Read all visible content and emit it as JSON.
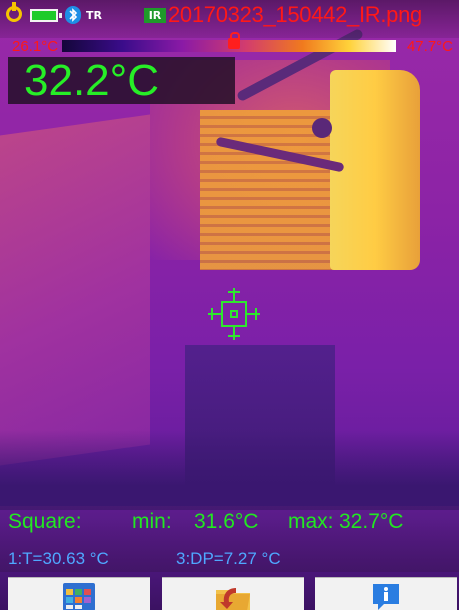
{
  "status_bar": {
    "icons": [
      "power-icon",
      "battery-icon",
      "bluetooth-icon",
      "tr-icon",
      "ir-image-icon"
    ],
    "tr_label": "TR",
    "ir_label": "IR",
    "filename": "20170323_150442_IR.png",
    "bluetooth_glyph": "฿",
    "colors": {
      "filename": "#ff1818",
      "battery": "#1ecb2a",
      "power": "#f5c400",
      "bluetooth": "#1e8fe6"
    }
  },
  "scale": {
    "min": "26.1°C",
    "max": "47.7°C",
    "lock_icon": "lock-icon"
  },
  "center_temp": "32.2°C",
  "measurement": {
    "square_label": "Square:",
    "min_label": "min:",
    "min_value": "31.6°C",
    "max_label": "max:",
    "max_value": "32.7°C",
    "point1": "1:T=30.63 °C",
    "point3": "3:DP=7.27 °C",
    "colors": {
      "measurement_text": "#22e822",
      "point_text": "#4fa8ff"
    }
  },
  "buttons": [
    {
      "name": "gallery-button",
      "icon": "gallery-grid-icon"
    },
    {
      "name": "folder-button",
      "icon": "folder-return-icon"
    },
    {
      "name": "info-button",
      "icon": "info-icon"
    }
  ]
}
